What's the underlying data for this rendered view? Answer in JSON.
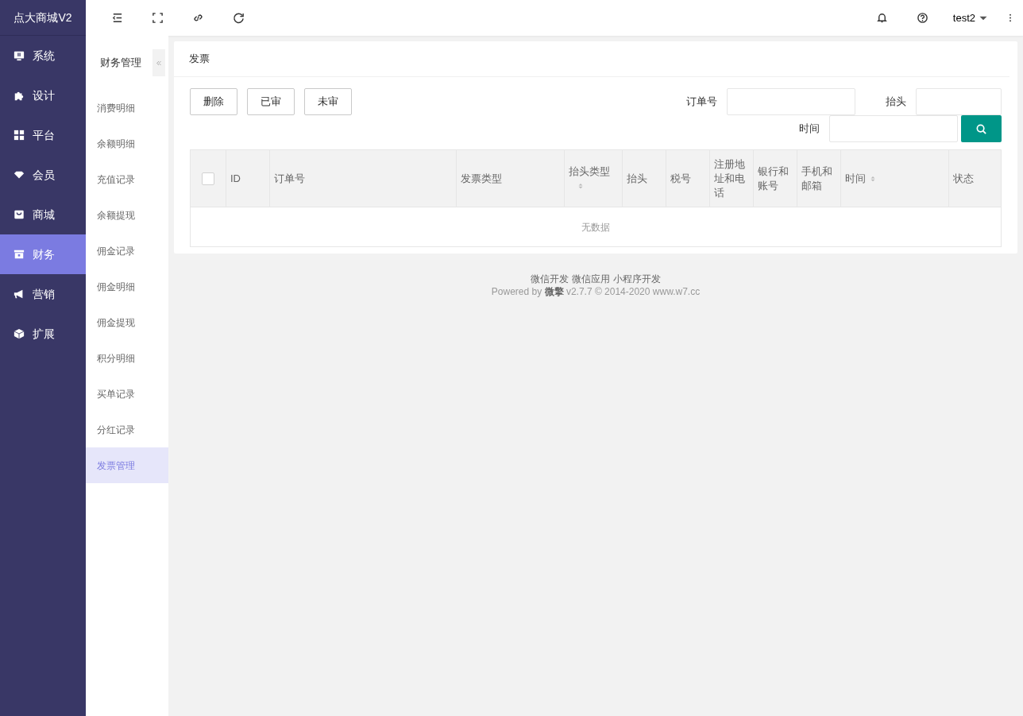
{
  "brand": "点大商城V2",
  "nav": [
    {
      "label": "系统",
      "kind": "monitor",
      "selected": false
    },
    {
      "label": "设计",
      "kind": "puzzle",
      "selected": false
    },
    {
      "label": "平台",
      "kind": "grid",
      "selected": false
    },
    {
      "label": "会员",
      "kind": "gem",
      "selected": false
    },
    {
      "label": "商城",
      "kind": "bag",
      "selected": false
    },
    {
      "label": "财务",
      "kind": "wallet",
      "selected": true
    },
    {
      "label": "营销",
      "kind": "megaphone",
      "selected": false
    },
    {
      "label": "扩展",
      "kind": "box",
      "selected": false
    }
  ],
  "user": {
    "name": "test2"
  },
  "subnav": {
    "title": "财务管理",
    "items": [
      {
        "label": "消费明细",
        "selected": false
      },
      {
        "label": "余额明细",
        "selected": false
      },
      {
        "label": "充值记录",
        "selected": false
      },
      {
        "label": "余额提现",
        "selected": false
      },
      {
        "label": "佣金记录",
        "selected": false
      },
      {
        "label": "佣金明细",
        "selected": false
      },
      {
        "label": "佣金提现",
        "selected": false
      },
      {
        "label": "积分明细",
        "selected": false
      },
      {
        "label": "买单记录",
        "selected": false
      },
      {
        "label": "分红记录",
        "selected": false
      },
      {
        "label": "发票管理",
        "selected": true
      }
    ]
  },
  "card": {
    "title": "发票",
    "actions": [
      "删除",
      "已审",
      "未审"
    ],
    "filter_rows": [
      [
        {
          "label": "订单号"
        },
        {
          "label": "抬头"
        }
      ],
      [
        {
          "label": "时间"
        }
      ]
    ],
    "table": {
      "select_all": {
        "checked": false
      },
      "columns": [
        {
          "label": "ID",
          "sortable": false
        },
        {
          "label": "订单号",
          "sortable": false
        },
        {
          "label": "发票类型",
          "sortable": false
        },
        {
          "label": "抬头类型",
          "sortable": true
        },
        {
          "label": "抬头",
          "sortable": false
        },
        {
          "label": "税号",
          "sortable": false
        },
        {
          "label": "注册地址和电话",
          "sortable": false
        },
        {
          "label": "银行和账号",
          "sortable": false
        },
        {
          "label": "手机和邮箱",
          "sortable": false
        },
        {
          "label": "时间",
          "sortable": true
        },
        {
          "label": "状态",
          "sortable": false
        }
      ],
      "empty_text": "无数据"
    }
  },
  "footer": {
    "links": [
      "微信开发",
      "微信应用",
      "小程序开发"
    ],
    "powered": "Powered by **微擎** v2.7.7 © 2014-2020 www.w7.cc"
  }
}
